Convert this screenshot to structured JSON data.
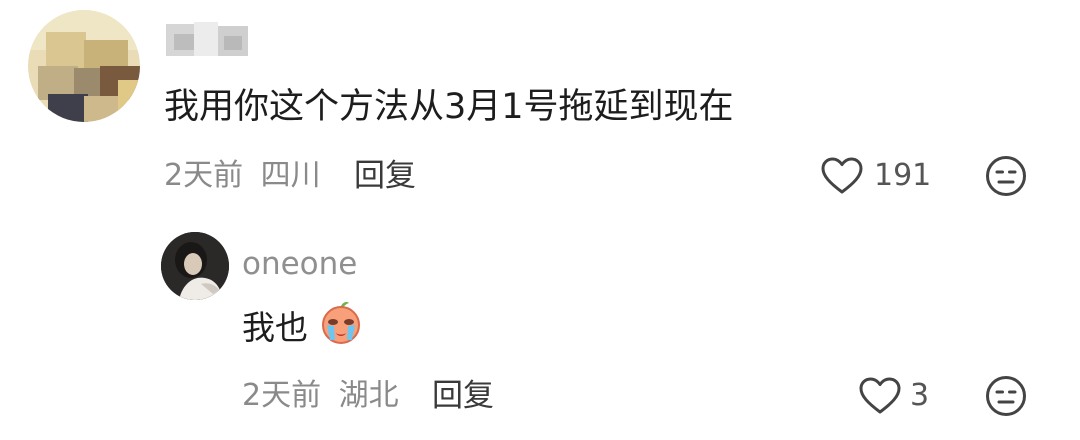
{
  "comment": {
    "text": "我用你这个方法从3月1号拖延到现在",
    "time": "2天前",
    "location": "四川",
    "reply_label": "回复",
    "like_count": "191"
  },
  "reply": {
    "username": "oneone",
    "text": "我也",
    "time": "2天前",
    "location": "湖北",
    "reply_label": "回复",
    "like_count": "3"
  },
  "icons": {
    "like": "heart-outline-icon",
    "dislike": "neutral-face-icon",
    "emoji": "crying-face-emoji"
  },
  "colors": {
    "text_primary": "#1d1d1d",
    "text_meta": "#8a8a8a",
    "icon_gray": "#444444"
  }
}
